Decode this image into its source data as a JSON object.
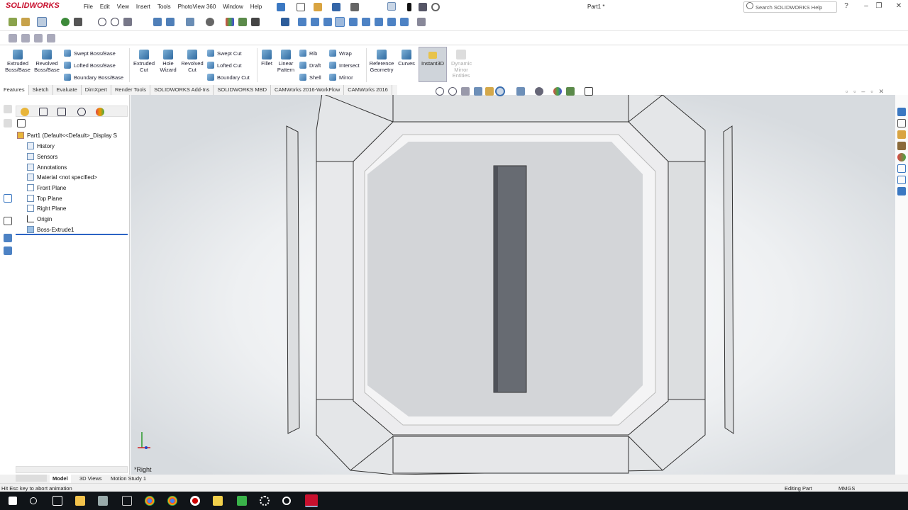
{
  "app": {
    "brand": "SOLIDWORKS",
    "document_title": "Part1 *"
  },
  "menu": [
    "File",
    "Edit",
    "View",
    "Insert",
    "Tools",
    "PhotoView 360",
    "Window",
    "Help"
  ],
  "search": {
    "placeholder": "Search SOLIDWORKS Help"
  },
  "commands": {
    "extruded_boss": "Extruded Boss/Base",
    "revolved_boss": "Revolved Boss/Base",
    "swept_boss": "Swept Boss/Base",
    "lofted_boss": "Lofted Boss/Base",
    "boundary_boss": "Boundary Boss/Base",
    "extruded_cut": "Extruded Cut",
    "hole_wizard": "Hole Wizard",
    "revolved_cut": "Revolved Cut",
    "swept_cut": "Swept Cut",
    "lofted_cut": "Lofted Cut",
    "boundary_cut": "Boundary Cut",
    "fillet": "Fillet",
    "linear_pattern": "Linear Pattern",
    "rib": "Rib",
    "draft": "Draft",
    "shell": "Shell",
    "wrap": "Wrap",
    "intersect": "Intersect",
    "mirror": "Mirror",
    "reference_geometry": "Reference Geometry",
    "curves": "Curves",
    "instant3d": "Instant3D",
    "dynamic_mirror": "Dynamic Mirror Entities"
  },
  "tabs": [
    "Features",
    "Sketch",
    "Evaluate",
    "DimXpert",
    "Render Tools",
    "SOLIDWORKS Add-Ins",
    "SOLIDWORKS MBD",
    "CAMWorks 2016-WorkFlow",
    "CAMWorks 2016"
  ],
  "tree": {
    "root": "Part1  (Default<<Default>_Display S",
    "items": [
      "History",
      "Sensors",
      "Annotations",
      "Material <not specified>",
      "Front Plane",
      "Top Plane",
      "Right Plane",
      "Origin",
      "Boss-Extrude1"
    ]
  },
  "viewport": {
    "view_label": "*Right"
  },
  "bottom_tabs": [
    "Model",
    "3D Views",
    "Motion Study 1"
  ],
  "status": {
    "message": "Hit Esc key to abort animation",
    "mode": "Editing Part",
    "units": "MMGS"
  }
}
